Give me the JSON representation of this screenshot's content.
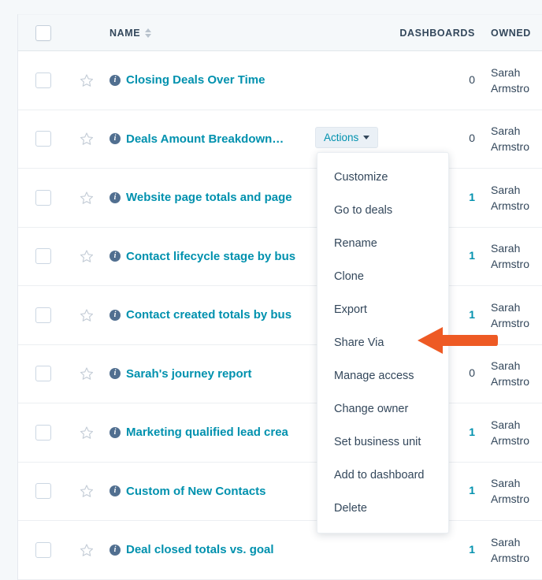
{
  "table": {
    "columns": {
      "select_all": "",
      "name": "NAME",
      "dashboards": "DASHBOARDS",
      "owner": "OWNED"
    },
    "sort_icon": "sort-arrows-icon",
    "rows": [
      {
        "name": "Closing Deals Over Time",
        "dashboards": "0",
        "dashboards_is_link": false,
        "owner_line1": "Sarah",
        "owner_line2": "Armstro"
      },
      {
        "name": "Deals Amount Breakdown…",
        "dashboards": "0",
        "dashboards_is_link": false,
        "owner_line1": "Sarah",
        "owner_line2": "Armstro"
      },
      {
        "name": "Website page totals and page",
        "dashboards": "1",
        "dashboards_is_link": true,
        "owner_line1": "Sarah",
        "owner_line2": "Armstro"
      },
      {
        "name": "Contact lifecycle stage by bus",
        "dashboards": "1",
        "dashboards_is_link": true,
        "owner_line1": "Sarah",
        "owner_line2": "Armstro"
      },
      {
        "name": "Contact created totals by bus",
        "dashboards": "1",
        "dashboards_is_link": true,
        "owner_line1": "Sarah",
        "owner_line2": "Armstro"
      },
      {
        "name": "Sarah's journey report",
        "dashboards": "0",
        "dashboards_is_link": false,
        "owner_line1": "Sarah",
        "owner_line2": "Armstro"
      },
      {
        "name": "Marketing qualified lead crea",
        "dashboards": "1",
        "dashboards_is_link": true,
        "owner_line1": "Sarah",
        "owner_line2": "Armstro"
      },
      {
        "name": "Custom of New Contacts",
        "dashboards": "1",
        "dashboards_is_link": true,
        "owner_line1": "Sarah",
        "owner_line2": "Armstro"
      },
      {
        "name": "Deal closed totals vs. goal",
        "dashboards": "1",
        "dashboards_is_link": true,
        "owner_line1": "Sarah",
        "owner_line2": "Armstro"
      }
    ],
    "row_info_icon": "info-circle-icon",
    "row_star_icon": "star-outline-icon",
    "row_checkbox": "checkbox-unchecked"
  },
  "actions_button": {
    "label": "Actions",
    "caret_icon": "caret-down-icon"
  },
  "dropdown_menu": {
    "items": [
      {
        "label": "Customize"
      },
      {
        "label": "Go to deals"
      },
      {
        "label": "Rename"
      },
      {
        "label": "Clone"
      },
      {
        "label": "Export"
      },
      {
        "label": "Share Via"
      },
      {
        "label": "Manage access"
      },
      {
        "label": "Change owner"
      },
      {
        "label": "Set business unit"
      },
      {
        "label": "Add to dashboard"
      },
      {
        "label": "Delete"
      }
    ]
  },
  "annotation": {
    "arrow_icon": "left-pointing-arrow",
    "arrow_color": "#EE5A24",
    "points_at": "Share Via"
  },
  "colors": {
    "link_teal": "#0091AE",
    "text_dark": "#33475B",
    "header_bg": "#F5F8FA",
    "row_border": "#ECEFF2",
    "info_icon": "#516F90",
    "accent_orange": "#EE5A24"
  }
}
